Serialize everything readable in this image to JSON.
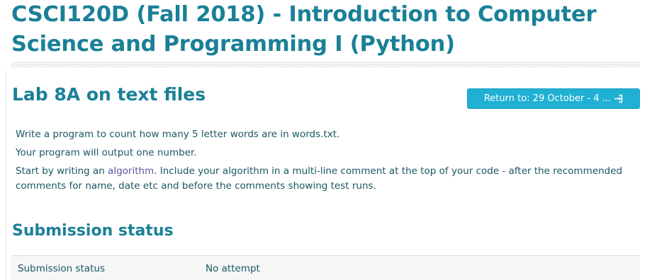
{
  "course": {
    "title": "CSCI120D (Fall 2018) - Introduction to Computer Science and Programming I (Python)"
  },
  "activity": {
    "title": "Lab 8A on text files"
  },
  "return_button": {
    "label": "Return to: 29 October - 4 ...",
    "icon": "sign-in-icon"
  },
  "intro": {
    "paragraph1": "Write a program to count how many 5 letter words are in words.txt.",
    "paragraph2": "Your program will output one number.",
    "paragraph3_before_link": "Start by writing an ",
    "paragraph3_link": "algorithm",
    "paragraph3_after_link": ". Include your algorithm in a multi-line comment at the top of your code - after the recommended comments for name, date etc and before the comments showing test runs."
  },
  "submission": {
    "section_title": "Submission status",
    "rows": [
      {
        "label": "Submission status",
        "value": "No attempt"
      }
    ]
  },
  "colors": {
    "heading": "#1a8097",
    "body_text": "#1a5763",
    "link": "#5a55a0",
    "button_bg": "#1fb0d3",
    "button_text": "#ffffff",
    "table_bg": "#f6f6f6"
  }
}
